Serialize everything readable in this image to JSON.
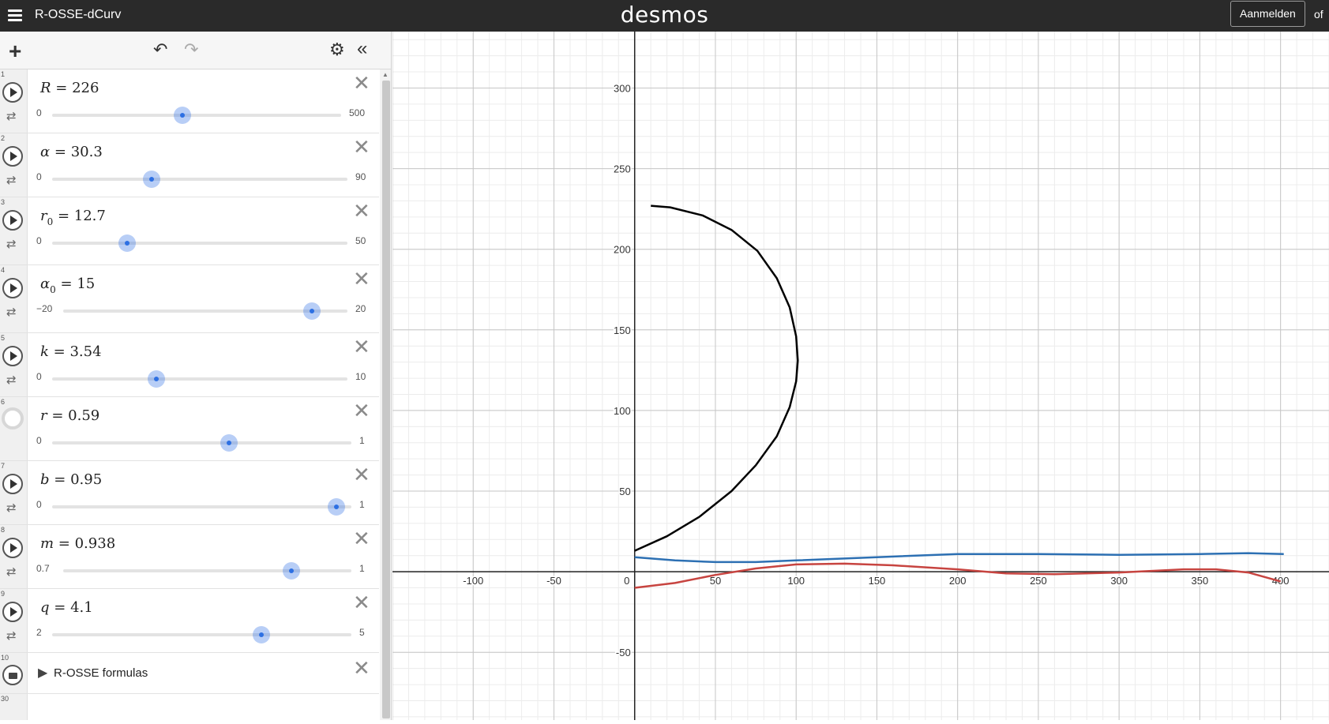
{
  "app": {
    "title": "R-OSSE-dCurv",
    "logo": "desmos",
    "login_label": "Aanmelden",
    "trailing_text": "of"
  },
  "toolbar": {
    "add_icon": "plus-icon",
    "undo_icon": "undo-icon",
    "redo_icon": "redo-icon",
    "settings_icon": "gear-icon",
    "collapse_icon": "double-chevron-left-icon"
  },
  "expressions": [
    {
      "index": "1",
      "var": "R",
      "sub": "",
      "value": "226",
      "min": "0",
      "max": "500",
      "fraction": 0.452,
      "icon": "play-icon"
    },
    {
      "index": "2",
      "var": "α",
      "sub": "",
      "value": "30.3",
      "min": "0",
      "max": "90",
      "fraction": 0.337,
      "icon": "play-icon"
    },
    {
      "index": "3",
      "var": "r",
      "sub": "0",
      "value": "12.7",
      "min": "0",
      "max": "50",
      "fraction": 0.254,
      "icon": "play-icon"
    },
    {
      "index": "4",
      "var": "α",
      "sub": "0",
      "value": "15",
      "min": "−20",
      "max": "20",
      "fraction": 0.875,
      "icon": "play-icon"
    },
    {
      "index": "5",
      "var": "k",
      "sub": "",
      "value": "3.54",
      "min": "0",
      "max": "10",
      "fraction": 0.354,
      "icon": "play-icon"
    },
    {
      "index": "6",
      "var": "r",
      "sub": "",
      "value": "0.59",
      "min": "0",
      "max": "1",
      "fraction": 0.59,
      "icon": "hidden-circle-icon"
    },
    {
      "index": "7",
      "var": "b",
      "sub": "",
      "value": "0.95",
      "min": "0",
      "max": "1",
      "fraction": 0.95,
      "icon": "play-icon"
    },
    {
      "index": "8",
      "var": "m",
      "sub": "",
      "value": "0.938",
      "min": "0.7",
      "max": "1",
      "fraction": 0.793,
      "icon": "play-icon"
    },
    {
      "index": "9",
      "var": "q",
      "sub": "",
      "value": "4.1",
      "min": "2",
      "max": "5",
      "fraction": 0.7,
      "icon": "play-icon"
    }
  ],
  "folder": {
    "index": "10",
    "label": "R-OSSE formulas",
    "icon": "folder-icon"
  },
  "next_index": "30",
  "graph": {
    "x_range": [
      -150,
      430
    ],
    "y_range": [
      -92,
      335
    ],
    "x_ticks": [
      "-100",
      "-50",
      "0",
      "50",
      "100",
      "150",
      "200",
      "250",
      "300",
      "350",
      "400"
    ],
    "y_ticks": [
      "300",
      "250",
      "200",
      "150",
      "100",
      "50",
      "-50"
    ],
    "colors": {
      "black": "#000000",
      "blue": "#2d70b3",
      "red": "#c74440",
      "axis": "#222222",
      "grid_major": "#c6c6c6",
      "grid_minor": "#ececec"
    }
  }
}
